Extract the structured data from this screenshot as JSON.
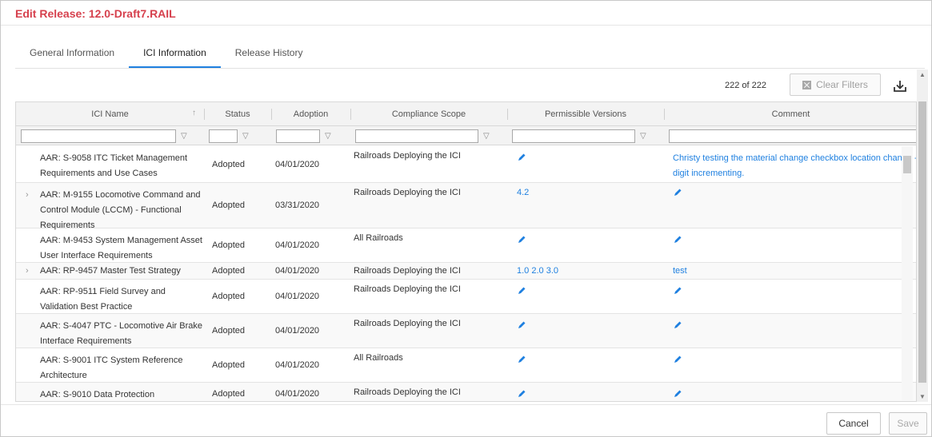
{
  "dialog": {
    "title": "Edit Release: 12.0-Draft7.RAIL"
  },
  "tabs": [
    {
      "label": "General Information",
      "active": false
    },
    {
      "label": "ICI Information",
      "active": true
    },
    {
      "label": "Release History",
      "active": false
    }
  ],
  "toolbar": {
    "count": "222 of 222",
    "clear_filters_label": "Clear Filters",
    "download_icon": "download-icon"
  },
  "grid": {
    "columns": [
      "ICI Name",
      "Status",
      "Adoption",
      "Compliance Scope",
      "Permissible Versions",
      "Comment"
    ],
    "rows": [
      {
        "name": "AAR: S-9058 ITC Ticket Management Requirements and Use Cases",
        "status": "Adopted",
        "adoption": "04/01/2020",
        "scope": "Railroads Deploying the ICI",
        "versions": "",
        "comment": "Christy testing the material change checkbox location change - digit incrementing.",
        "expandable": false
      },
      {
        "name": "AAR: M-9155 Locomotive Command and Control Module (LCCM) - Functional Requirements",
        "status": "Adopted",
        "adoption": "03/31/2020",
        "scope": "Railroads Deploying the ICI",
        "versions": "4.2",
        "comment": "",
        "expandable": true
      },
      {
        "name": "AAR: M-9453 System Management Asset User Interface Requirements",
        "status": "Adopted",
        "adoption": "04/01/2020",
        "scope": "All Railroads",
        "versions": "",
        "comment": "",
        "expandable": false
      },
      {
        "name": "AAR: RP-9457 Master Test Strategy",
        "status": "Adopted",
        "adoption": "04/01/2020",
        "scope": "Railroads Deploying the ICI",
        "versions": "1.0 2.0 3.0",
        "comment": "test",
        "expandable": true
      },
      {
        "name": "AAR: RP-9511 Field Survey and Validation Best Practice",
        "status": "Adopted",
        "adoption": "04/01/2020",
        "scope": "Railroads Deploying the ICI",
        "versions": "",
        "comment": "",
        "expandable": false
      },
      {
        "name": "AAR: S-4047 PTC - Locomotive Air Brake Interface Requirements",
        "status": "Adopted",
        "adoption": "04/01/2020",
        "scope": "Railroads Deploying the ICI",
        "versions": "",
        "comment": "",
        "expandable": false
      },
      {
        "name": "AAR: S-9001 ITC System Reference Architecture",
        "status": "Adopted",
        "adoption": "04/01/2020",
        "scope": "All Railroads",
        "versions": "",
        "comment": "",
        "expandable": false
      },
      {
        "name": "AAR: S-9010 Data Protection",
        "status": "Adopted",
        "adoption": "04/01/2020",
        "scope": "Railroads Deploying the ICI",
        "versions": "",
        "comment": "",
        "expandable": false
      }
    ]
  },
  "footer": {
    "cancel_label": "Cancel",
    "save_label": "Save"
  },
  "colors": {
    "title": "#d6404d",
    "accent": "#1f80e0"
  }
}
